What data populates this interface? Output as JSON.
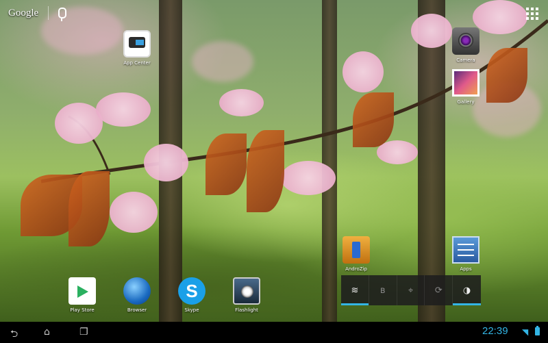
{
  "search_bar": {
    "brand": "Google"
  },
  "desktop_apps": [
    {
      "id": "app-center",
      "label": "App Center",
      "icon": "app-center-icon"
    },
    {
      "id": "camera",
      "label": "Camera",
      "icon": "camera-icon"
    },
    {
      "id": "gallery",
      "label": "Gallery",
      "icon": "gallery-icon"
    },
    {
      "id": "androzip",
      "label": "AndroZip",
      "icon": "androzip-icon"
    },
    {
      "id": "apps",
      "label": "Apps",
      "icon": "apps-settings-icon"
    }
  ],
  "dock_apps": [
    {
      "id": "play-store",
      "label": "Play Store",
      "icon": "play-store-icon"
    },
    {
      "id": "browser",
      "label": "Browser",
      "icon": "browser-globe-icon"
    },
    {
      "id": "skype",
      "label": "Skype",
      "icon": "skype-icon",
      "glyph": "S"
    },
    {
      "id": "flashlight",
      "label": "Flashlight",
      "icon": "flashlight-icon"
    }
  ],
  "quick_settings": {
    "toggles": [
      {
        "id": "wifi",
        "icon": "wifi-icon",
        "glyph": "≋",
        "state": "on"
      },
      {
        "id": "bluetooth",
        "icon": "bluetooth-icon",
        "glyph": "ʙ",
        "state": "off"
      },
      {
        "id": "gps",
        "icon": "gps-icon",
        "glyph": "⌖",
        "state": "off"
      },
      {
        "id": "sync",
        "icon": "sync-icon",
        "glyph": "⟳",
        "state": "off"
      },
      {
        "id": "brightness",
        "icon": "brightness-icon",
        "glyph": "◑",
        "state": "on"
      }
    ],
    "accent_color": "#33b5e5"
  },
  "status_bar": {
    "time": "22:39"
  }
}
